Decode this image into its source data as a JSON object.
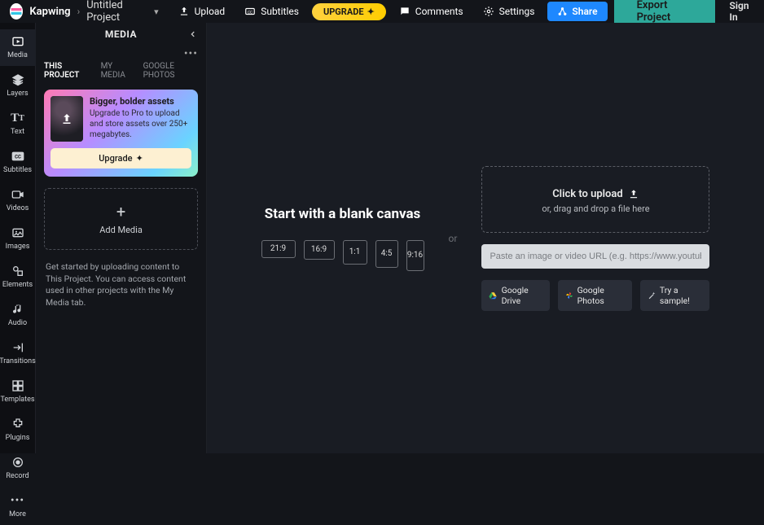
{
  "header": {
    "brand": "Kapwing",
    "project_name": "Untitled Project",
    "upload": "Upload",
    "subtitles": "Subtitles",
    "upgrade_pill": "UPGRADE",
    "comments": "Comments",
    "settings": "Settings",
    "share": "Share",
    "export": "Export Project",
    "signin": "Sign In"
  },
  "rail": {
    "media": "Media",
    "layers": "Layers",
    "text": "Text",
    "subtitles": "Subtitles",
    "videos": "Videos",
    "images": "Images",
    "elements": "Elements",
    "audio": "Audio",
    "transitions": "Transitions",
    "templates": "Templates",
    "plugins": "Plugins",
    "record": "Record",
    "more": "More"
  },
  "panel": {
    "title": "MEDIA",
    "tabs": {
      "project": "THIS PROJECT",
      "my_media": "MY MEDIA",
      "google_photos": "GOOGLE PHOTOS"
    },
    "promo": {
      "title": "Bigger, bolder assets",
      "desc": "Upgrade to Pro to upload and store assets over 250+ megabytes.",
      "btn": "Upgrade"
    },
    "add_media": "Add Media",
    "helper": "Get started by uploading content to This Project. You can access content used in other projects with the My Media tab."
  },
  "canvas": {
    "blank_title": "Start with a blank canvas",
    "ratios": {
      "r219": "21:9",
      "r169": "16:9",
      "r11": "1:1",
      "r45": "4:5",
      "r916": "9:16"
    },
    "or": "or",
    "dropzone_title": "Click to upload",
    "dropzone_sub": "or, drag and drop a file here",
    "url_placeholder": "Paste an image or video URL (e.g. https://www.youtube.com",
    "gdrive": "Google Drive",
    "gphotos": "Google Photos",
    "sample": "Try a sample!"
  }
}
